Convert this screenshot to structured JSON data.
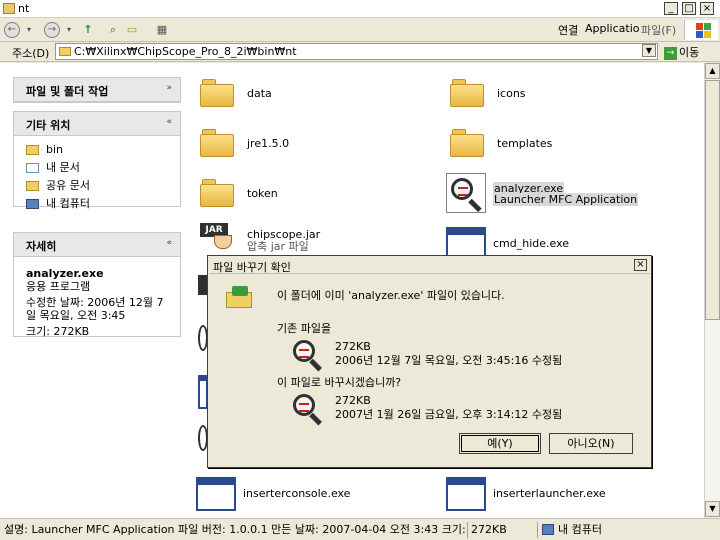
{
  "window": {
    "title": "nt",
    "minimize": "_",
    "maximize": "□",
    "close": "×"
  },
  "toolbar": {
    "back": "←",
    "forward": "→",
    "up": "↑",
    "search": "⌕",
    "views": "▦"
  },
  "menu": {
    "connect": "연결",
    "application": "Applicatio",
    "file": "파일(F)"
  },
  "address": {
    "label": "주소(D)",
    "path": "C:₩Xilinx₩ChipScope_Pro_8_2i₩bin₩nt",
    "dropdown": "▼",
    "go": "이동",
    "go_arrow": "→"
  },
  "left_panel": {
    "tasks": {
      "title": "파일 및 폴더 작업",
      "toggle": "»"
    },
    "places": {
      "title": "기타 위치",
      "toggle": "«",
      "items": [
        "bin",
        "내 문서",
        "공유 문서",
        "내 컴퓨터"
      ]
    },
    "details": {
      "title": "자세히",
      "toggle": "«",
      "name": "analyzer.exe",
      "type": "응용 프로그램",
      "modified_line1": "수정한 날짜: 2006년 12월 7",
      "modified_line2": "일 목요일, 오전 3:45",
      "size": "크기: 272KB"
    }
  },
  "files": [
    {
      "name": "data",
      "kind": "folder"
    },
    {
      "name": "icons",
      "kind": "folder"
    },
    {
      "name": "jre1.5.0",
      "kind": "folder"
    },
    {
      "name": "templates",
      "kind": "folder"
    },
    {
      "name": "token",
      "kind": "folder"
    },
    {
      "name": "analyzer.exe",
      "desc": "Launcher MFC Application",
      "kind": "exe-selected"
    },
    {
      "name": "chipscope.jar",
      "desc": "압축 jar 파일",
      "kind": "jar"
    },
    {
      "name": "cmd_hide.exe",
      "kind": "exe"
    },
    {
      "name": "inserterconsole.exe",
      "kind": "exe"
    },
    {
      "name": "inserterlauncher.exe",
      "kind": "exe"
    }
  ],
  "dialog": {
    "title": "파일 바꾸기 확인",
    "close": "×",
    "message": "이 폴더에 이미 'analyzer.exe' 파일이 있습니다.",
    "existing_label": "기존 파일을",
    "existing_size": "272KB",
    "existing_date": "2006년 12월 7일 목요일, 오전 3:45:16 수정됨",
    "replace_label": "이 파일로 바꾸시겠습니까?",
    "new_size": "272KB",
    "new_date": "2007년 1월 26일 금요일, 오후 3:14:12 수정됨",
    "yes_button": "예(Y)",
    "no_button": "아니오(N)"
  },
  "status": {
    "description": "설명: Launcher MFC Application 파일 버전: 1.0.0.1 만든 날짜: 2007-04-04 오전 3:43 크기: 27",
    "size": "272KB",
    "location": "내 컴퓨터"
  },
  "scrollbar": {
    "up": "▲",
    "down": "▼"
  }
}
